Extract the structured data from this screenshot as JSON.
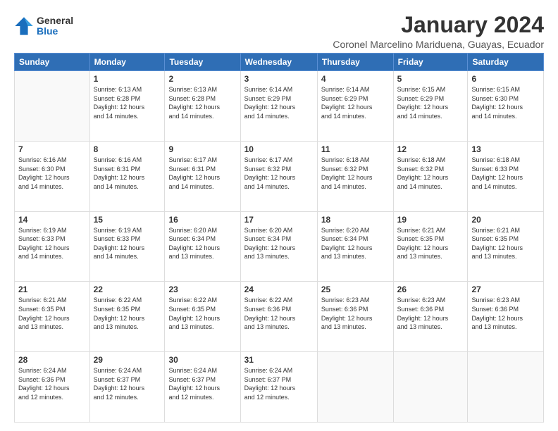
{
  "header": {
    "logo_general": "General",
    "logo_blue": "Blue",
    "month_title": "January 2024",
    "location": "Coronel Marcelino Mariduena, Guayas, Ecuador"
  },
  "days_of_week": [
    "Sunday",
    "Monday",
    "Tuesday",
    "Wednesday",
    "Thursday",
    "Friday",
    "Saturday"
  ],
  "weeks": [
    [
      {
        "day": "",
        "info": ""
      },
      {
        "day": "1",
        "info": "Sunrise: 6:13 AM\nSunset: 6:28 PM\nDaylight: 12 hours\nand 14 minutes."
      },
      {
        "day": "2",
        "info": "Sunrise: 6:13 AM\nSunset: 6:28 PM\nDaylight: 12 hours\nand 14 minutes."
      },
      {
        "day": "3",
        "info": "Sunrise: 6:14 AM\nSunset: 6:29 PM\nDaylight: 12 hours\nand 14 minutes."
      },
      {
        "day": "4",
        "info": "Sunrise: 6:14 AM\nSunset: 6:29 PM\nDaylight: 12 hours\nand 14 minutes."
      },
      {
        "day": "5",
        "info": "Sunrise: 6:15 AM\nSunset: 6:29 PM\nDaylight: 12 hours\nand 14 minutes."
      },
      {
        "day": "6",
        "info": "Sunrise: 6:15 AM\nSunset: 6:30 PM\nDaylight: 12 hours\nand 14 minutes."
      }
    ],
    [
      {
        "day": "7",
        "info": "Sunrise: 6:16 AM\nSunset: 6:30 PM\nDaylight: 12 hours\nand 14 minutes."
      },
      {
        "day": "8",
        "info": "Sunrise: 6:16 AM\nSunset: 6:31 PM\nDaylight: 12 hours\nand 14 minutes."
      },
      {
        "day": "9",
        "info": "Sunrise: 6:17 AM\nSunset: 6:31 PM\nDaylight: 12 hours\nand 14 minutes."
      },
      {
        "day": "10",
        "info": "Sunrise: 6:17 AM\nSunset: 6:32 PM\nDaylight: 12 hours\nand 14 minutes."
      },
      {
        "day": "11",
        "info": "Sunrise: 6:18 AM\nSunset: 6:32 PM\nDaylight: 12 hours\nand 14 minutes."
      },
      {
        "day": "12",
        "info": "Sunrise: 6:18 AM\nSunset: 6:32 PM\nDaylight: 12 hours\nand 14 minutes."
      },
      {
        "day": "13",
        "info": "Sunrise: 6:18 AM\nSunset: 6:33 PM\nDaylight: 12 hours\nand 14 minutes."
      }
    ],
    [
      {
        "day": "14",
        "info": "Sunrise: 6:19 AM\nSunset: 6:33 PM\nDaylight: 12 hours\nand 14 minutes."
      },
      {
        "day": "15",
        "info": "Sunrise: 6:19 AM\nSunset: 6:33 PM\nDaylight: 12 hours\nand 14 minutes."
      },
      {
        "day": "16",
        "info": "Sunrise: 6:20 AM\nSunset: 6:34 PM\nDaylight: 12 hours\nand 13 minutes."
      },
      {
        "day": "17",
        "info": "Sunrise: 6:20 AM\nSunset: 6:34 PM\nDaylight: 12 hours\nand 13 minutes."
      },
      {
        "day": "18",
        "info": "Sunrise: 6:20 AM\nSunset: 6:34 PM\nDaylight: 12 hours\nand 13 minutes."
      },
      {
        "day": "19",
        "info": "Sunrise: 6:21 AM\nSunset: 6:35 PM\nDaylight: 12 hours\nand 13 minutes."
      },
      {
        "day": "20",
        "info": "Sunrise: 6:21 AM\nSunset: 6:35 PM\nDaylight: 12 hours\nand 13 minutes."
      }
    ],
    [
      {
        "day": "21",
        "info": "Sunrise: 6:21 AM\nSunset: 6:35 PM\nDaylight: 12 hours\nand 13 minutes."
      },
      {
        "day": "22",
        "info": "Sunrise: 6:22 AM\nSunset: 6:35 PM\nDaylight: 12 hours\nand 13 minutes."
      },
      {
        "day": "23",
        "info": "Sunrise: 6:22 AM\nSunset: 6:35 PM\nDaylight: 12 hours\nand 13 minutes."
      },
      {
        "day": "24",
        "info": "Sunrise: 6:22 AM\nSunset: 6:36 PM\nDaylight: 12 hours\nand 13 minutes."
      },
      {
        "day": "25",
        "info": "Sunrise: 6:23 AM\nSunset: 6:36 PM\nDaylight: 12 hours\nand 13 minutes."
      },
      {
        "day": "26",
        "info": "Sunrise: 6:23 AM\nSunset: 6:36 PM\nDaylight: 12 hours\nand 13 minutes."
      },
      {
        "day": "27",
        "info": "Sunrise: 6:23 AM\nSunset: 6:36 PM\nDaylight: 12 hours\nand 13 minutes."
      }
    ],
    [
      {
        "day": "28",
        "info": "Sunrise: 6:24 AM\nSunset: 6:36 PM\nDaylight: 12 hours\nand 12 minutes."
      },
      {
        "day": "29",
        "info": "Sunrise: 6:24 AM\nSunset: 6:37 PM\nDaylight: 12 hours\nand 12 minutes."
      },
      {
        "day": "30",
        "info": "Sunrise: 6:24 AM\nSunset: 6:37 PM\nDaylight: 12 hours\nand 12 minutes."
      },
      {
        "day": "31",
        "info": "Sunrise: 6:24 AM\nSunset: 6:37 PM\nDaylight: 12 hours\nand 12 minutes."
      },
      {
        "day": "",
        "info": ""
      },
      {
        "day": "",
        "info": ""
      },
      {
        "day": "",
        "info": ""
      }
    ]
  ]
}
